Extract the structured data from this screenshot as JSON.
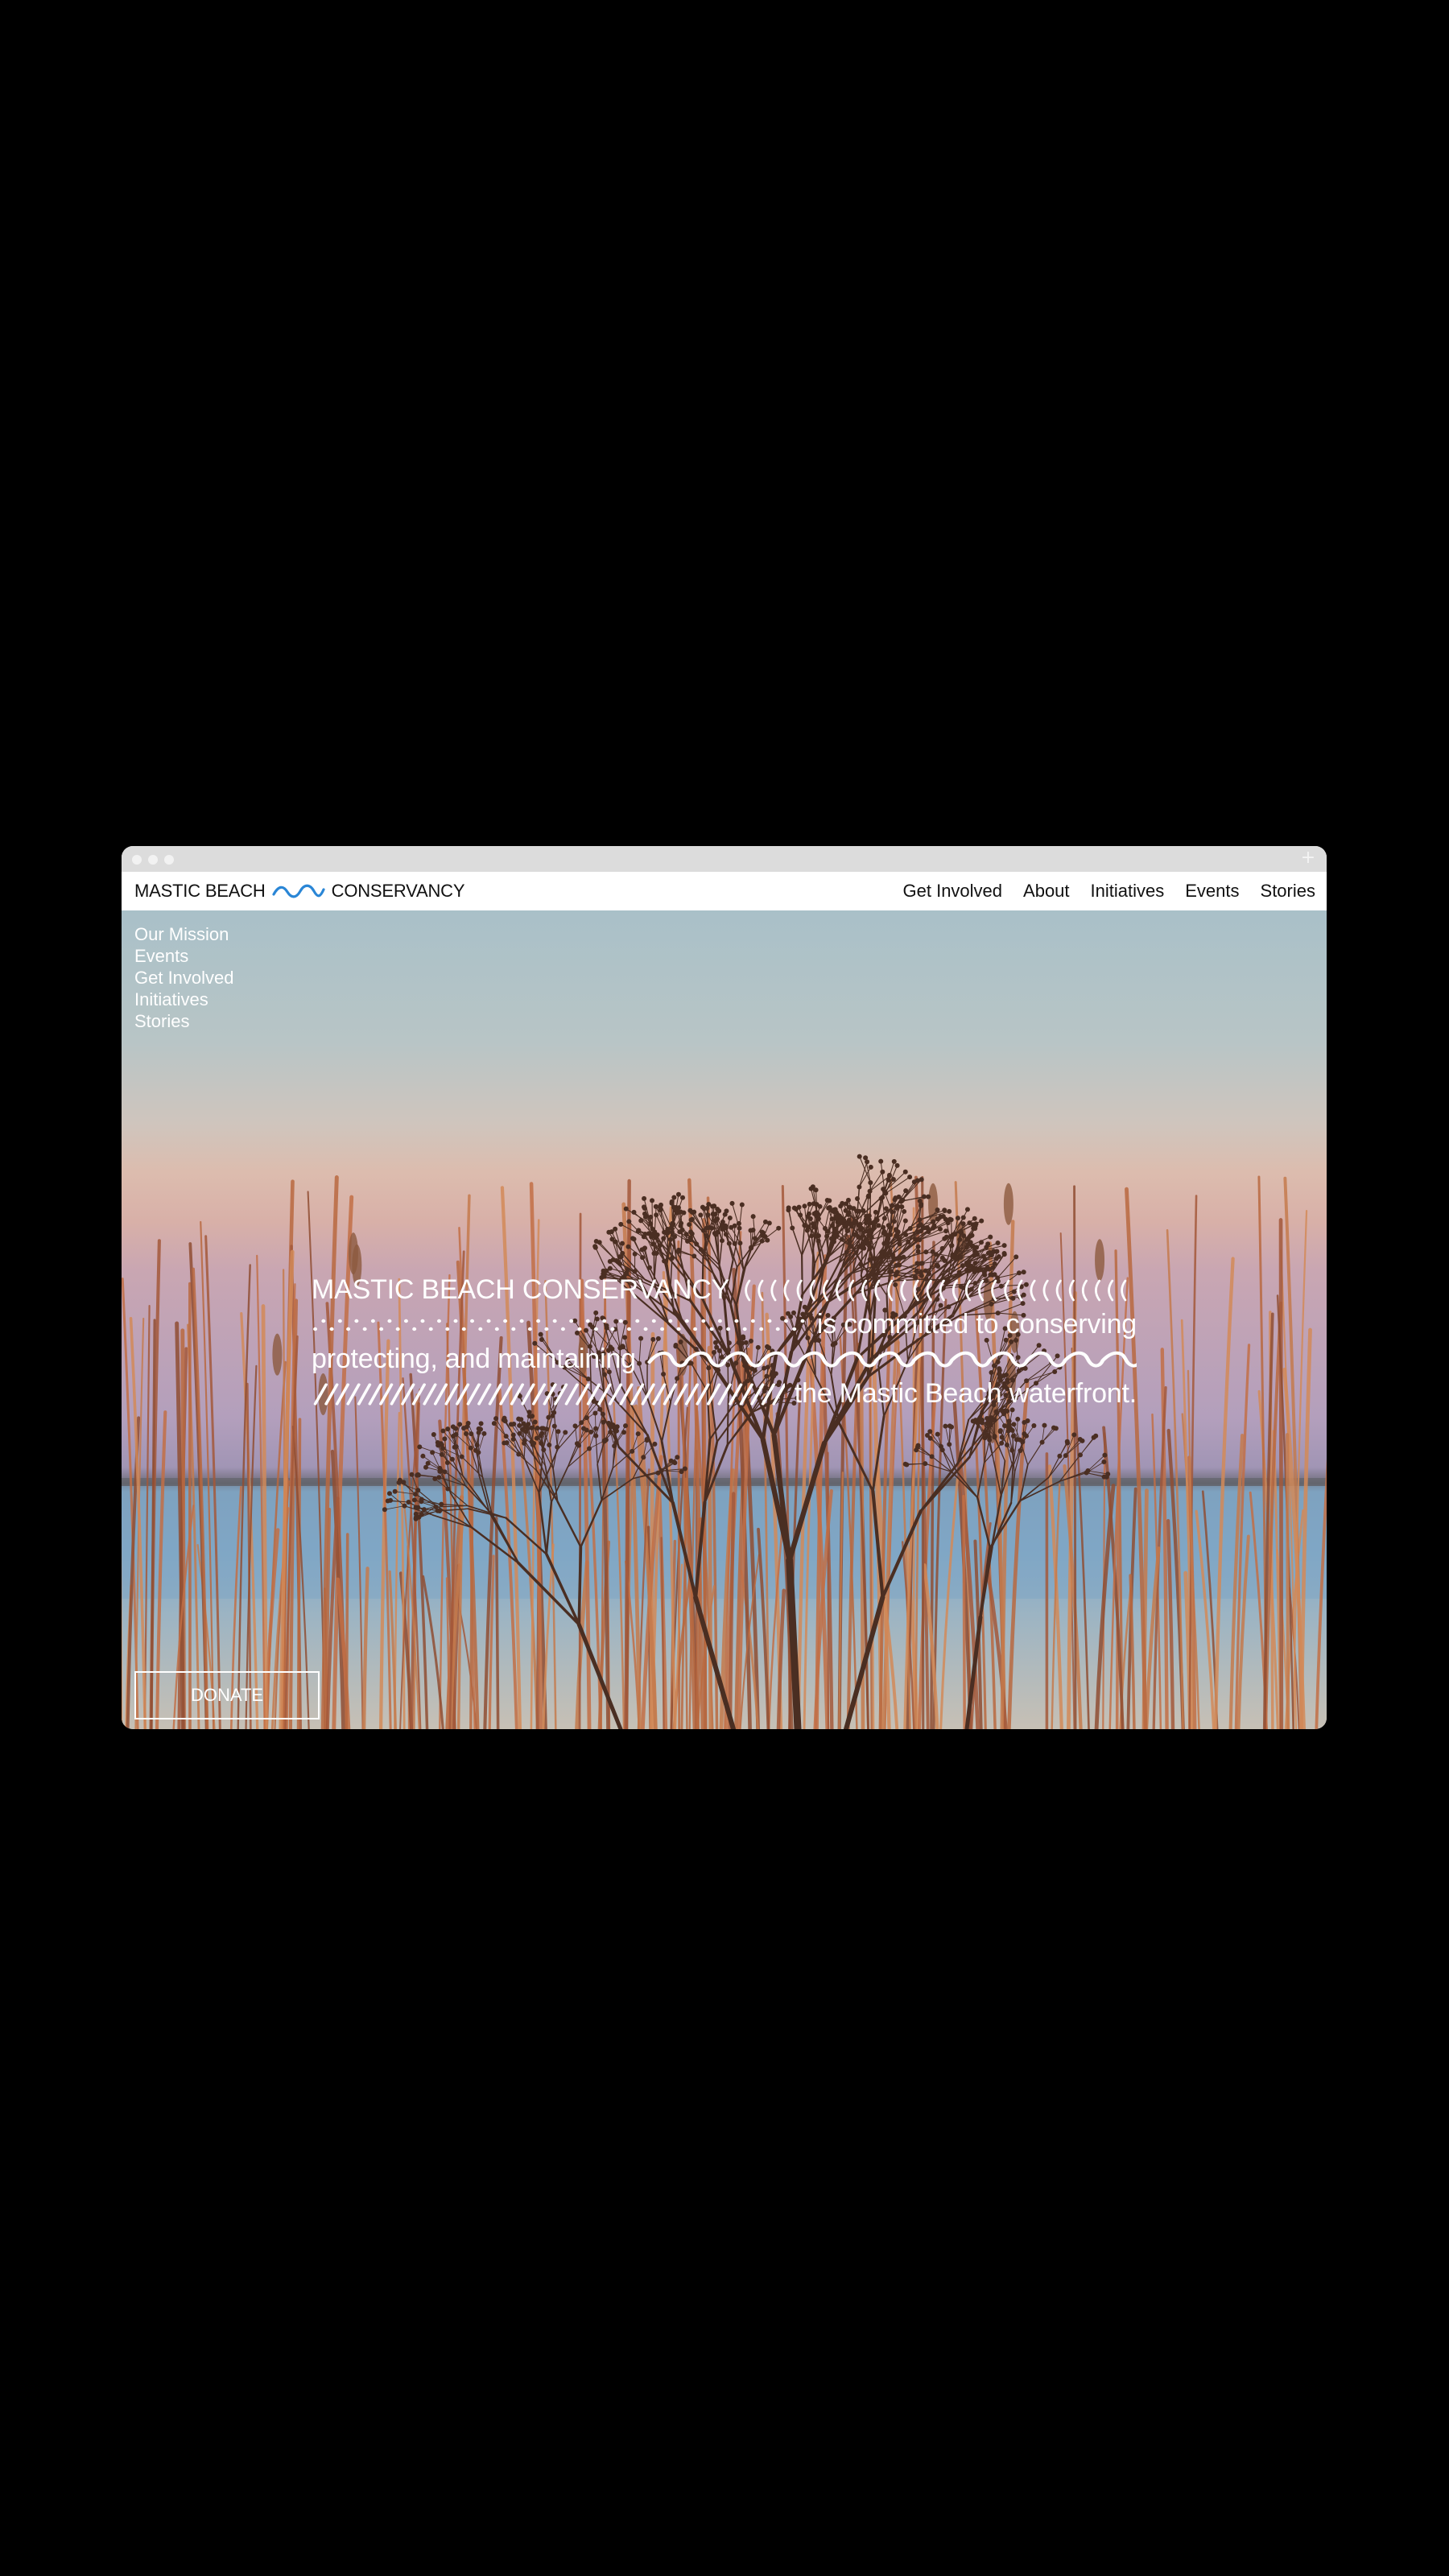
{
  "brand": {
    "name_left": "MASTIC BEACH",
    "name_right": "CONSERVANCY",
    "wave_color": "#2a86d6"
  },
  "chrome": {
    "window_dots": [
      "close-dot",
      "minimize-dot",
      "zoom-dot"
    ],
    "new_tab_icon": "plus-icon"
  },
  "nav": {
    "items": [
      {
        "label": "Get Involved"
      },
      {
        "label": "About"
      },
      {
        "label": "Initiatives"
      },
      {
        "label": "Events"
      },
      {
        "label": "Stories"
      }
    ]
  },
  "side_menu": {
    "items": [
      {
        "label": "Our Mission"
      },
      {
        "label": "Events"
      },
      {
        "label": "Get Involved"
      },
      {
        "label": "Initiatives"
      },
      {
        "label": "Stories"
      }
    ]
  },
  "statement": {
    "line1": "MASTIC BEACH CONSERVANCY",
    "line2": "is committed to conserving",
    "line3": "protecting, and maintaining",
    "line4": "the Mastic Beach waterfront."
  },
  "donate": {
    "label": "DONATE"
  },
  "colors": {
    "page_bg": "#000000",
    "navbar_bg": "#ffffff",
    "text_on_hero": "#ffffff"
  }
}
